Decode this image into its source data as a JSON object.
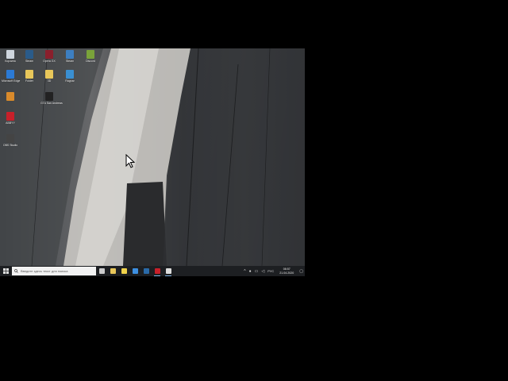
{
  "desktop": {
    "icons": [
      {
        "name": "recycle-bin-icon",
        "label": "Корзина",
        "color": "#cfd6de"
      },
      {
        "name": "app-icon-2",
        "label": "Steam",
        "color": "#2a5b8a"
      },
      {
        "name": "app-icon-3",
        "label": "Opera GX",
        "color": "#8a1f2c"
      },
      {
        "name": "app-icon-4",
        "label": "Steam",
        "color": "#3d7fc1"
      },
      {
        "name": "app-icon-5",
        "label": "Discord",
        "color": "#7aa33a"
      },
      {
        "name": "edge-icon",
        "label": "Microsoft Edge",
        "color": "#2b7ad6"
      },
      {
        "name": "folder-icon-1",
        "label": "Folder",
        "color": "#e8c75a"
      },
      {
        "name": "folder-icon-2",
        "label": "3D",
        "color": "#e8c75a"
      },
      {
        "name": "app-icon-9",
        "label": "Ragnar",
        "color": "#3a8fd1"
      },
      {
        "name": "settings-icon",
        "label": "",
        "color": "#d98a2b"
      },
      {
        "name": "game-icon",
        "label": "GTA San Andreas",
        "color": "#222222"
      },
      {
        "name": "app-icon-12",
        "label": "ABBYY",
        "color": "#c8202a"
      },
      {
        "name": "obs-icon",
        "label": "OBS Studio",
        "color": "#444444"
      }
    ]
  },
  "taskbar": {
    "search_placeholder": "Введите здесь текст для поиска",
    "apps": [
      {
        "name": "task-view-icon",
        "color": "#cccccc",
        "active": false
      },
      {
        "name": "file-explorer-icon",
        "color": "#e8c75a",
        "active": false
      },
      {
        "name": "store-icon",
        "color": "#f0d24a",
        "active": false
      },
      {
        "name": "mail-icon",
        "color": "#3d8fe0",
        "active": false
      },
      {
        "name": "steam-taskbar-icon",
        "color": "#2a6aa8",
        "active": false
      },
      {
        "name": "opera-taskbar-icon",
        "color": "#c8202a",
        "active": true
      },
      {
        "name": "clock-app-icon",
        "color": "#dddddd",
        "active": true
      }
    ],
    "tray": {
      "lang": "РУС",
      "time": "08:57",
      "date": "21.04.2020"
    }
  }
}
